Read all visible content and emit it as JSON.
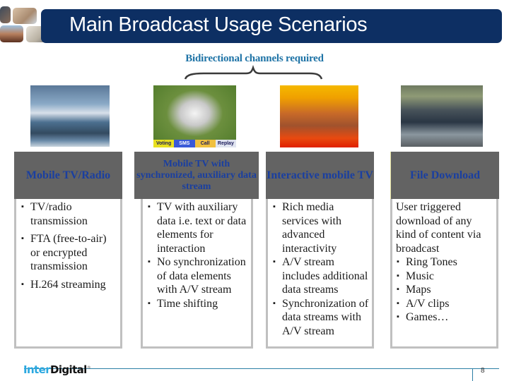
{
  "slide": {
    "title": "Main Broadcast Usage Scenarios",
    "subtitle": "Bidirectional channels required",
    "page_number": "8",
    "logo": {
      "part1": "Inter",
      "part2": "Digital",
      "mark": "®"
    },
    "colors": {
      "title_bar": "#0d2f63",
      "subtitle": "#1e73a6",
      "column_header_bg": "#636363",
      "column_header_text": "#1a3fa0",
      "footer_line": "#2c7fa5"
    }
  },
  "images": [
    {
      "name": "sydney-opera-house-tv-broadcast"
    },
    {
      "name": "football-celebration-with-buttons",
      "buttons": [
        "Voting",
        "SMS",
        "Call",
        "Replay"
      ]
    },
    {
      "name": "game-scores-interactive-screen"
    },
    {
      "name": "racing-game-screenshot"
    }
  ],
  "columns": [
    {
      "header": "Mobile TV/Radio",
      "bullets": [
        "TV/radio transmission",
        "FTA (free-to-air) or encrypted transmission",
        "H.264 streaming"
      ]
    },
    {
      "header": "Mobile TV with synchronized, auxiliary data stream",
      "bullets": [
        "TV with auxiliary data i.e. text or data elements for interaction",
        "No synchronization of data elements with A/V stream",
        "Time shifting"
      ]
    },
    {
      "header": "Interactive mobile TV",
      "bullets": [
        "Rich media services with advanced interactivity",
        "A/V stream includes additional data streams",
        "Synchronization of data streams  with A/V stream"
      ]
    },
    {
      "header": "File Download",
      "intro": "User triggered download of any kind of content via broadcast",
      "bullets": [
        "Ring Tones",
        "Music",
        "Maps",
        "A/V clips",
        "Games…"
      ]
    }
  ]
}
